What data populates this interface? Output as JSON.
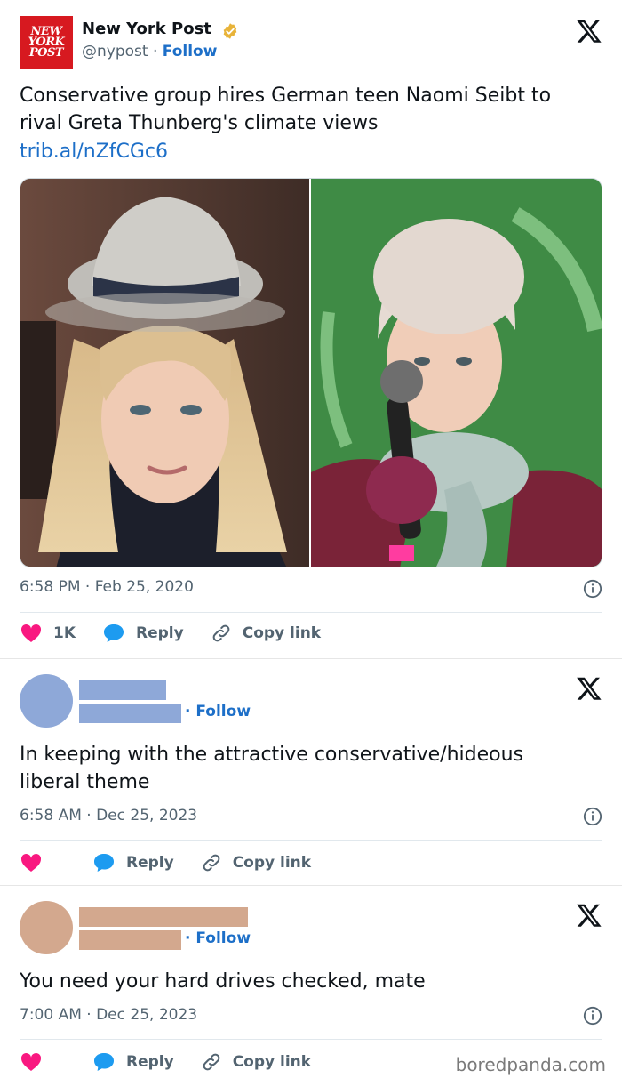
{
  "colors": {
    "accent": "#1d6fc8",
    "brand_red": "#d71920",
    "like_pink": "#f91880",
    "reply_blue": "#1d9bf0",
    "redact_blue": "#8ea8d8",
    "redact_tan": "#d3a88e"
  },
  "main_tweet": {
    "logo_lines": [
      "NEW",
      "YORK",
      "POST"
    ],
    "account_name": "New York Post",
    "handle": "@nypost",
    "separator": " · ",
    "follow_label": "Follow",
    "text": "Conservative group hires German teen Naomi Seibt to rival Greta Thunberg's climate views",
    "link": "trib.al/nZfCGc6",
    "timestamp": "6:58 PM · Feb 25, 2020",
    "like_count": "1K",
    "reply_label": "Reply",
    "copy_label": "Copy link",
    "icons": [
      "x-logo-icon",
      "verified-badge-icon",
      "info-icon",
      "heart-icon",
      "reply-bubble-icon",
      "link-icon"
    ]
  },
  "replies": [
    {
      "follow_label": "· Follow",
      "text": "In keeping with the attractive conservative/hideous liberal theme",
      "timestamp": "6:58 AM · Dec 25, 2023",
      "reply_label": "Reply",
      "copy_label": "Copy link"
    },
    {
      "follow_label": "· Follow",
      "text": "You need your hard drives checked, mate",
      "timestamp": "7:00 AM · Dec 25, 2023",
      "reply_label": "Reply",
      "copy_label": "Copy link"
    }
  ],
  "watermark": "boredpanda.com"
}
